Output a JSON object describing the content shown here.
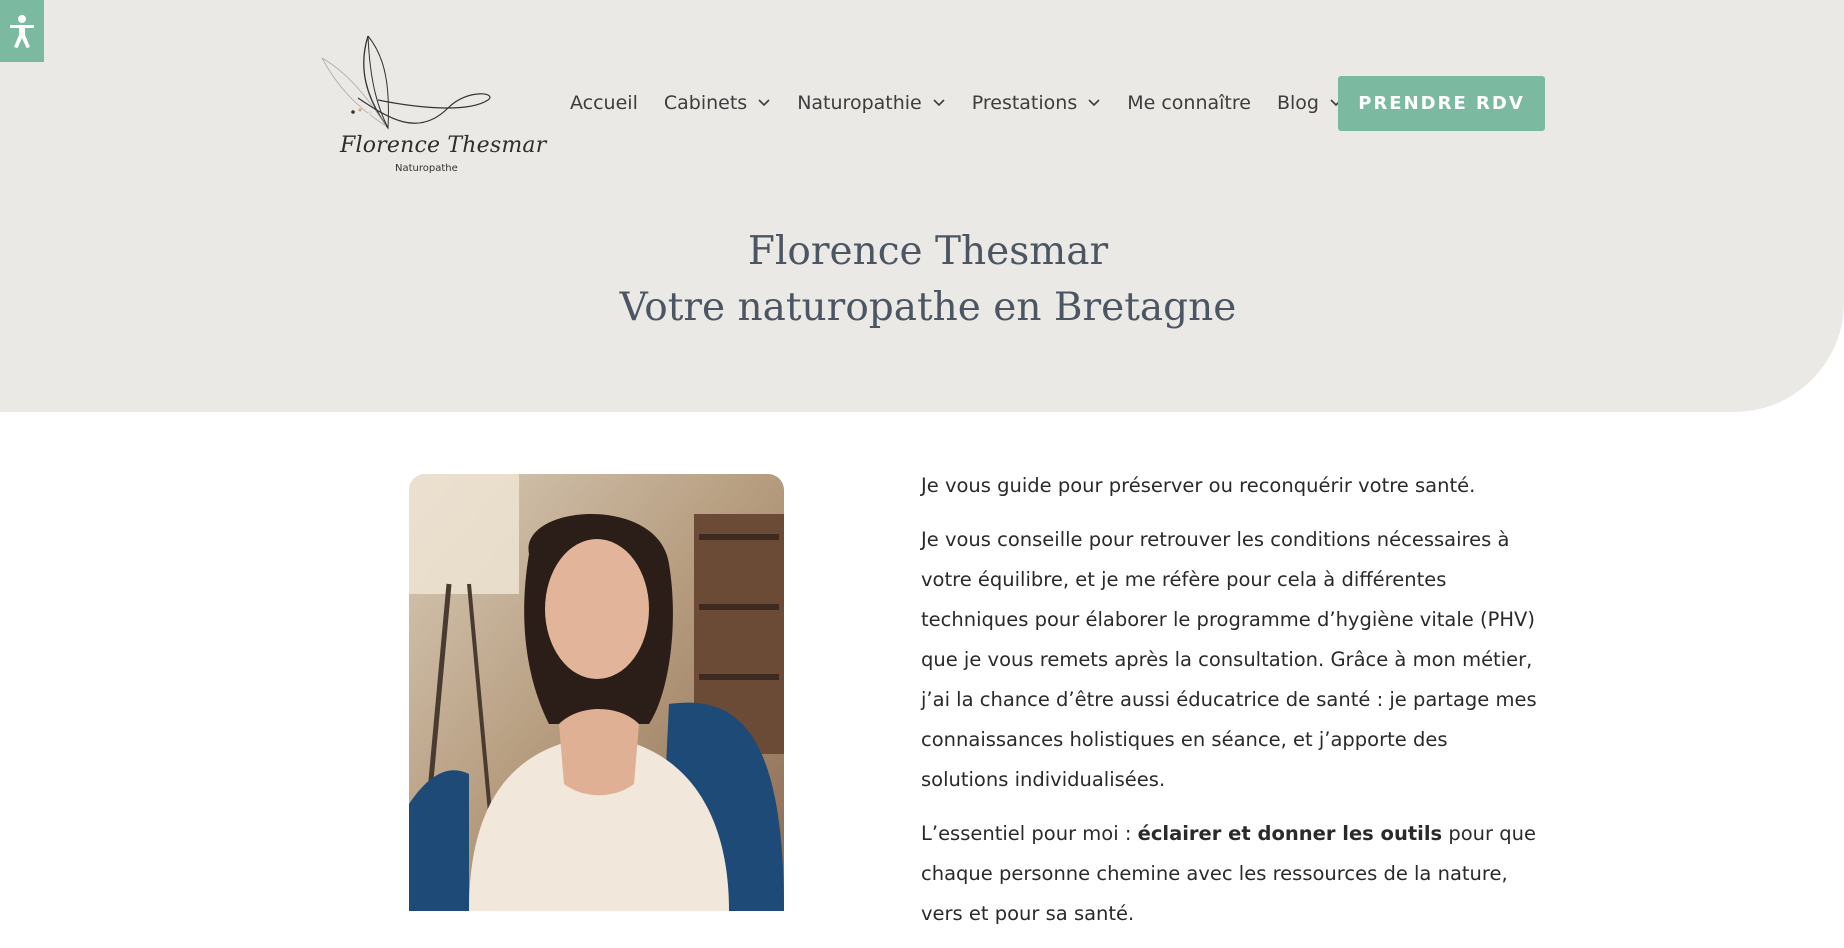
{
  "accessibility": {
    "icon": "accessibility-person-icon"
  },
  "logo": {
    "name": "Florence Thesmar",
    "subtitle": "Naturopathe"
  },
  "nav": {
    "items": [
      {
        "label": "Accueil"
      },
      {
        "label": "Cabinets"
      },
      {
        "label": "Naturopathie"
      },
      {
        "label": "Prestations"
      },
      {
        "label": "Me connaître"
      },
      {
        "label": "Blog"
      }
    ],
    "cta": "PRENDRE RDV"
  },
  "hero": {
    "line1": "Florence Thesmar",
    "line2": "Votre naturopathe en Bretagne"
  },
  "content": {
    "p1": "Je vous guide pour préserver ou reconquérir votre santé.",
    "p2": "Je vous conseille pour retrouver les conditions nécessaires à votre équilibre, et je me réfère pour cela à différentes techniques pour élaborer le programme d’hygiène vitale (PHV) que je vous remets après la consultation. Grâce à mon métier, j’ai la chance d’être aussi éducatrice de santé : je partage mes connaissances holistiques en séance, et j’apporte des solutions individualisées.",
    "p3_before": "L’essentiel pour moi : ",
    "p3_bold": "éclairer et donner les outils",
    "p3_after": " pour que chaque personne chemine avec les ressources de la nature, vers et pour sa santé."
  },
  "colors": {
    "accent": "#7bbaa0",
    "hero_bg": "#ebe9e5",
    "title": "#4c5662"
  }
}
